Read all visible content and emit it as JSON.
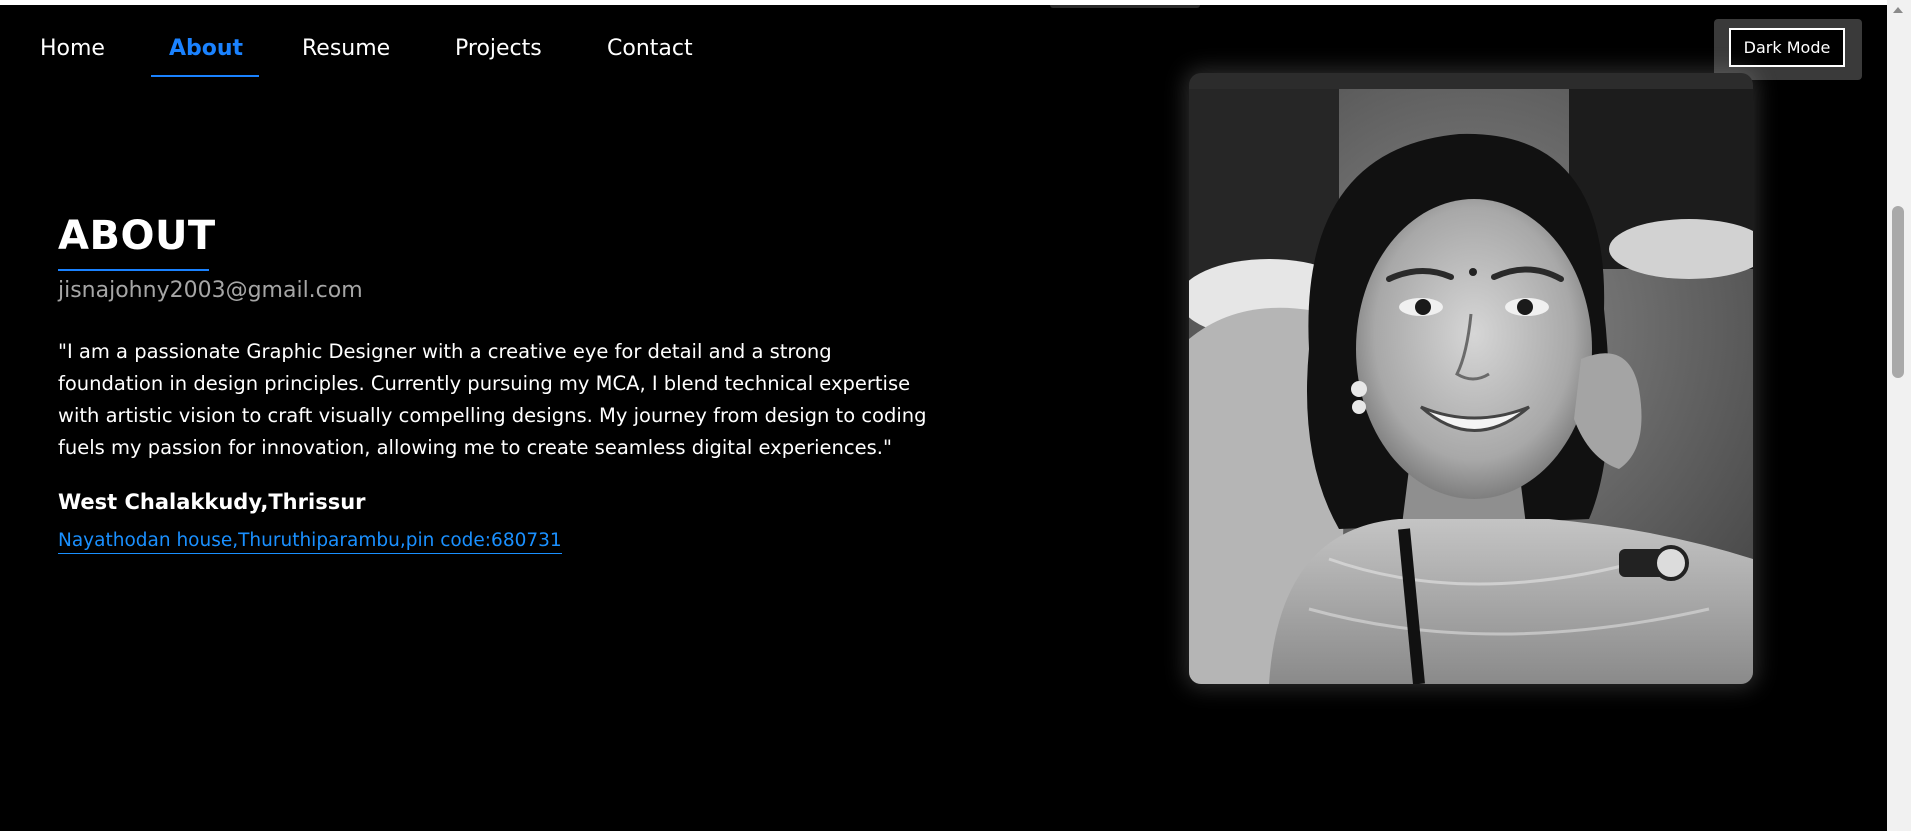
{
  "nav": {
    "items": [
      {
        "label": "Home"
      },
      {
        "label": "About"
      },
      {
        "label": "Resume"
      },
      {
        "label": "Projects"
      },
      {
        "label": "Contact"
      }
    ],
    "active_index": 1,
    "dark_mode_label": "Dark Mode"
  },
  "about": {
    "title": "ABOUT",
    "email": "jisnajohny2003@gmail.com",
    "bio_lines": [
      "\"I am a passionate Graphic Designer with a creative eye for detail and a strong",
      "foundation in design principles. Currently pursuing my MCA, I blend technical expertise",
      "with artistic vision to craft visually compelling designs. My journey from design to coding",
      "fuels my passion for innovation, allowing me to create seamless digital experiences.\""
    ],
    "location": "West Chalakkudy,Thrissur",
    "address": "Nayathodan house,Thuruthiparambu,pin code:680731"
  },
  "colors": {
    "background": "#000000",
    "accent": "#1a82ff",
    "text": "#ffffff",
    "muted": "#a6a6a6"
  },
  "profile_photo": {
    "description_icon": "portrait-photo",
    "style": "black-and-white"
  }
}
